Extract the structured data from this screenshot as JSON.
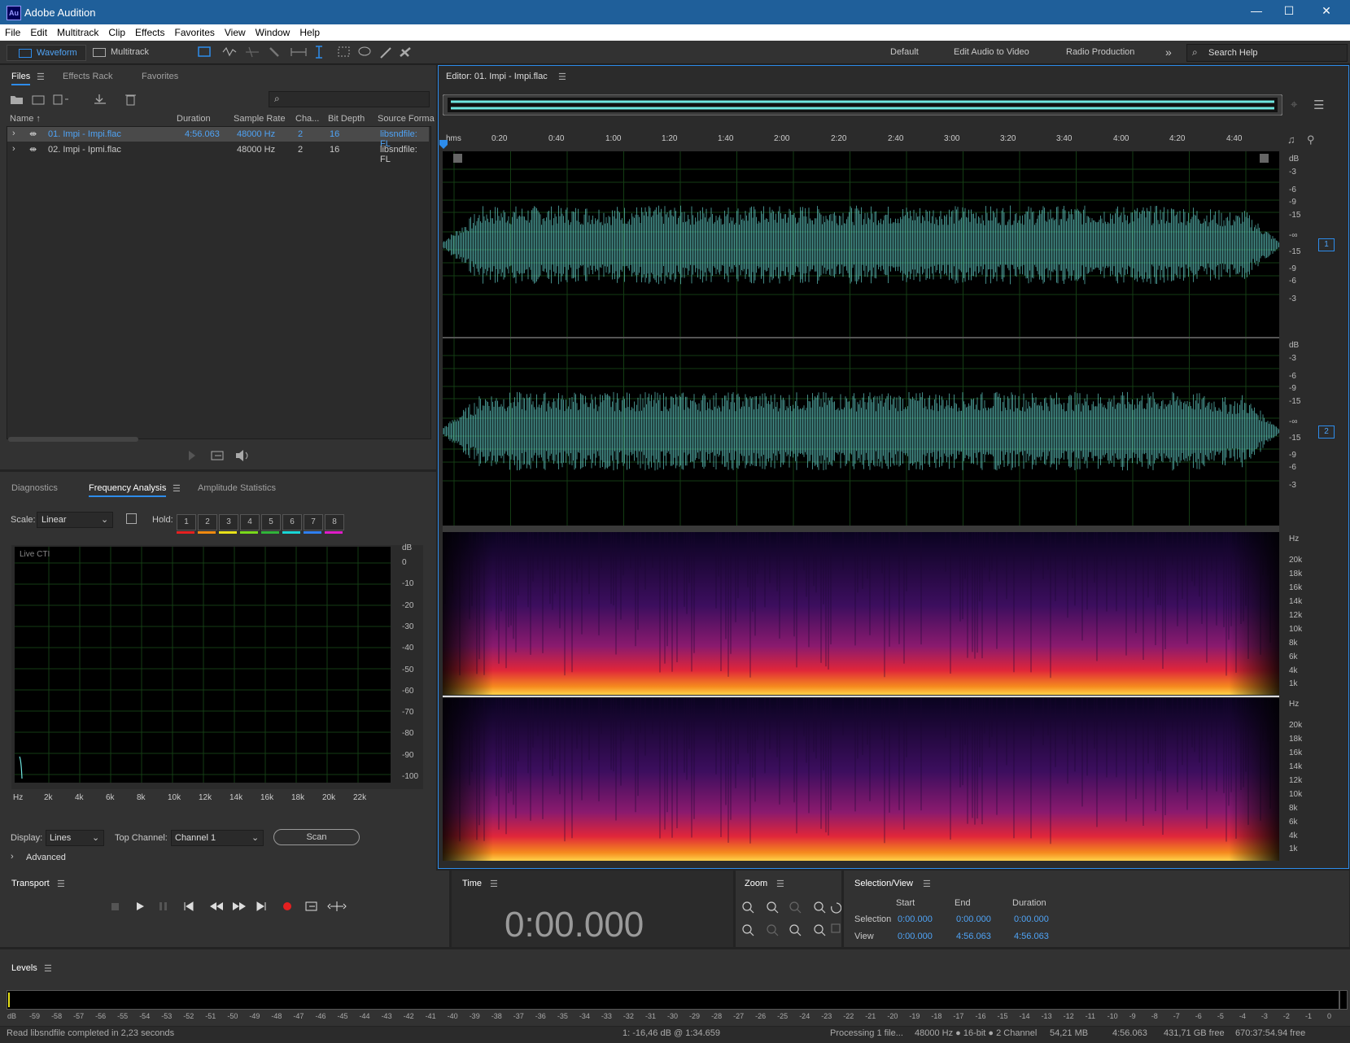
{
  "app": {
    "title": "Adobe Audition",
    "logo": "Au"
  },
  "window_controls": [
    "—",
    "☐",
    "✕"
  ],
  "menu": [
    "File",
    "Edit",
    "Multitrack",
    "Clip",
    "Effects",
    "Favorites",
    "View",
    "Window",
    "Help"
  ],
  "toolbar": {
    "waveform_label": "Waveform",
    "multitrack_label": "Multitrack",
    "workspaces": [
      "Default",
      "Edit Audio to Video",
      "Radio Production"
    ],
    "more": "»",
    "search_placeholder": "Search Help"
  },
  "files_panel": {
    "tabs": [
      "Files",
      "Effects Rack",
      "Favorites"
    ],
    "columns": [
      "Name ↑",
      "Duration",
      "Sample Rate",
      "Cha...",
      "Bit Depth",
      "Source Forma"
    ],
    "rows": [
      {
        "name": "01. Impi - Impi.flac",
        "duration": "4:56.063",
        "sample_rate": "48000 Hz",
        "channels": "2",
        "bit_depth": "16",
        "source_format": "libsndfile: FL"
      },
      {
        "name": "02. Impi - Ipmi.flac",
        "duration": "",
        "sample_rate": "48000 Hz",
        "channels": "2",
        "bit_depth": "16",
        "source_format": "libsndfile: FL"
      }
    ]
  },
  "analysis_panel": {
    "tabs": [
      "Diagnostics",
      "Frequency Analysis",
      "Amplitude Statistics"
    ],
    "scale_label": "Scale:",
    "scale_value": "Linear",
    "hold_label": "Hold:",
    "holds": [
      "1",
      "2",
      "3",
      "4",
      "5",
      "6",
      "7",
      "8"
    ],
    "hold_colors": [
      "#e52020",
      "#f08a10",
      "#e8e21a",
      "#7ad91c",
      "#31b53a",
      "#19d6d6",
      "#2f7ff0",
      "#e01cc8"
    ],
    "live_cti": "Live CTI",
    "db_labels": [
      "dB",
      "0",
      "-10",
      "-20",
      "-30",
      "-40",
      "-50",
      "-60",
      "-70",
      "-80",
      "-90",
      "-100"
    ],
    "hz_labels": [
      "Hz",
      "2k",
      "4k",
      "6k",
      "8k",
      "10k",
      "12k",
      "14k",
      "16k",
      "18k",
      "20k",
      "22k"
    ],
    "display_label": "Display:",
    "display_value": "Lines",
    "top_channel_label": "Top Channel:",
    "top_channel_value": "Channel 1",
    "scan_label": "Scan",
    "advanced_label": "Advanced"
  },
  "editor": {
    "title": "Editor: 01. Impi - Impi.flac",
    "ruler": [
      "hms",
      "0:20",
      "0:40",
      "1:00",
      "1:20",
      "1:40",
      "2:00",
      "2:20",
      "2:40",
      "3:00",
      "3:20",
      "3:40",
      "4:00",
      "4:20",
      "4:40"
    ],
    "db_scale": [
      "dB",
      "-3",
      "-6",
      "-9",
      "-15",
      "-∞",
      "-15",
      "-9",
      "-6",
      "-3"
    ],
    "channels": [
      "1",
      "2"
    ],
    "hz_scale": [
      "Hz",
      "20k",
      "18k",
      "16k",
      "14k",
      "12k",
      "10k",
      "8k",
      "6k",
      "4k",
      "1k"
    ]
  },
  "transport": {
    "title": "Transport"
  },
  "time": {
    "title": "Time",
    "value": "0:00.000"
  },
  "zoom": {
    "title": "Zoom"
  },
  "selection_view": {
    "title": "Selection/View",
    "headers": [
      "Start",
      "End",
      "Duration"
    ],
    "rows": [
      {
        "label": "Selection",
        "start": "0:00.000",
        "end": "0:00.000",
        "duration": "0:00.000"
      },
      {
        "label": "View",
        "start": "0:00.000",
        "end": "4:56.063",
        "duration": "4:56.063"
      }
    ]
  },
  "levels": {
    "title": "Levels",
    "scale": [
      "dB",
      "-59",
      "-58",
      "-57",
      "-56",
      "-55",
      "-54",
      "-53",
      "-52",
      "-51",
      "-50",
      "-49",
      "-48",
      "-47",
      "-46",
      "-45",
      "-44",
      "-43",
      "-42",
      "-41",
      "-40",
      "-39",
      "-38",
      "-37",
      "-36",
      "-35",
      "-34",
      "-33",
      "-32",
      "-31",
      "-30",
      "-29",
      "-28",
      "-27",
      "-26",
      "-25",
      "-24",
      "-23",
      "-22",
      "-21",
      "-20",
      "-19",
      "-18",
      "-17",
      "-16",
      "-15",
      "-14",
      "-13",
      "-12",
      "-11",
      "-10",
      "-9",
      "-8",
      "-7",
      "-6",
      "-5",
      "-4",
      "-3",
      "-2",
      "-1",
      "0"
    ]
  },
  "status": {
    "left": "Read libsndfile completed in 2,23 seconds",
    "cursor": "1: -16,46 dB @ 1:34.659",
    "processing": "Processing 1 file...",
    "format": "48000 Hz ● 16-bit ● 2 Channel",
    "size": "54,21 MB",
    "duration": "4:56.063",
    "free": "431,71 GB free",
    "time_free": "670:37:54.94 free"
  },
  "colors": {
    "accent": "#2d8ceb",
    "waveform": "#6fe6e0",
    "background": "#232323",
    "panel": "#323232"
  }
}
